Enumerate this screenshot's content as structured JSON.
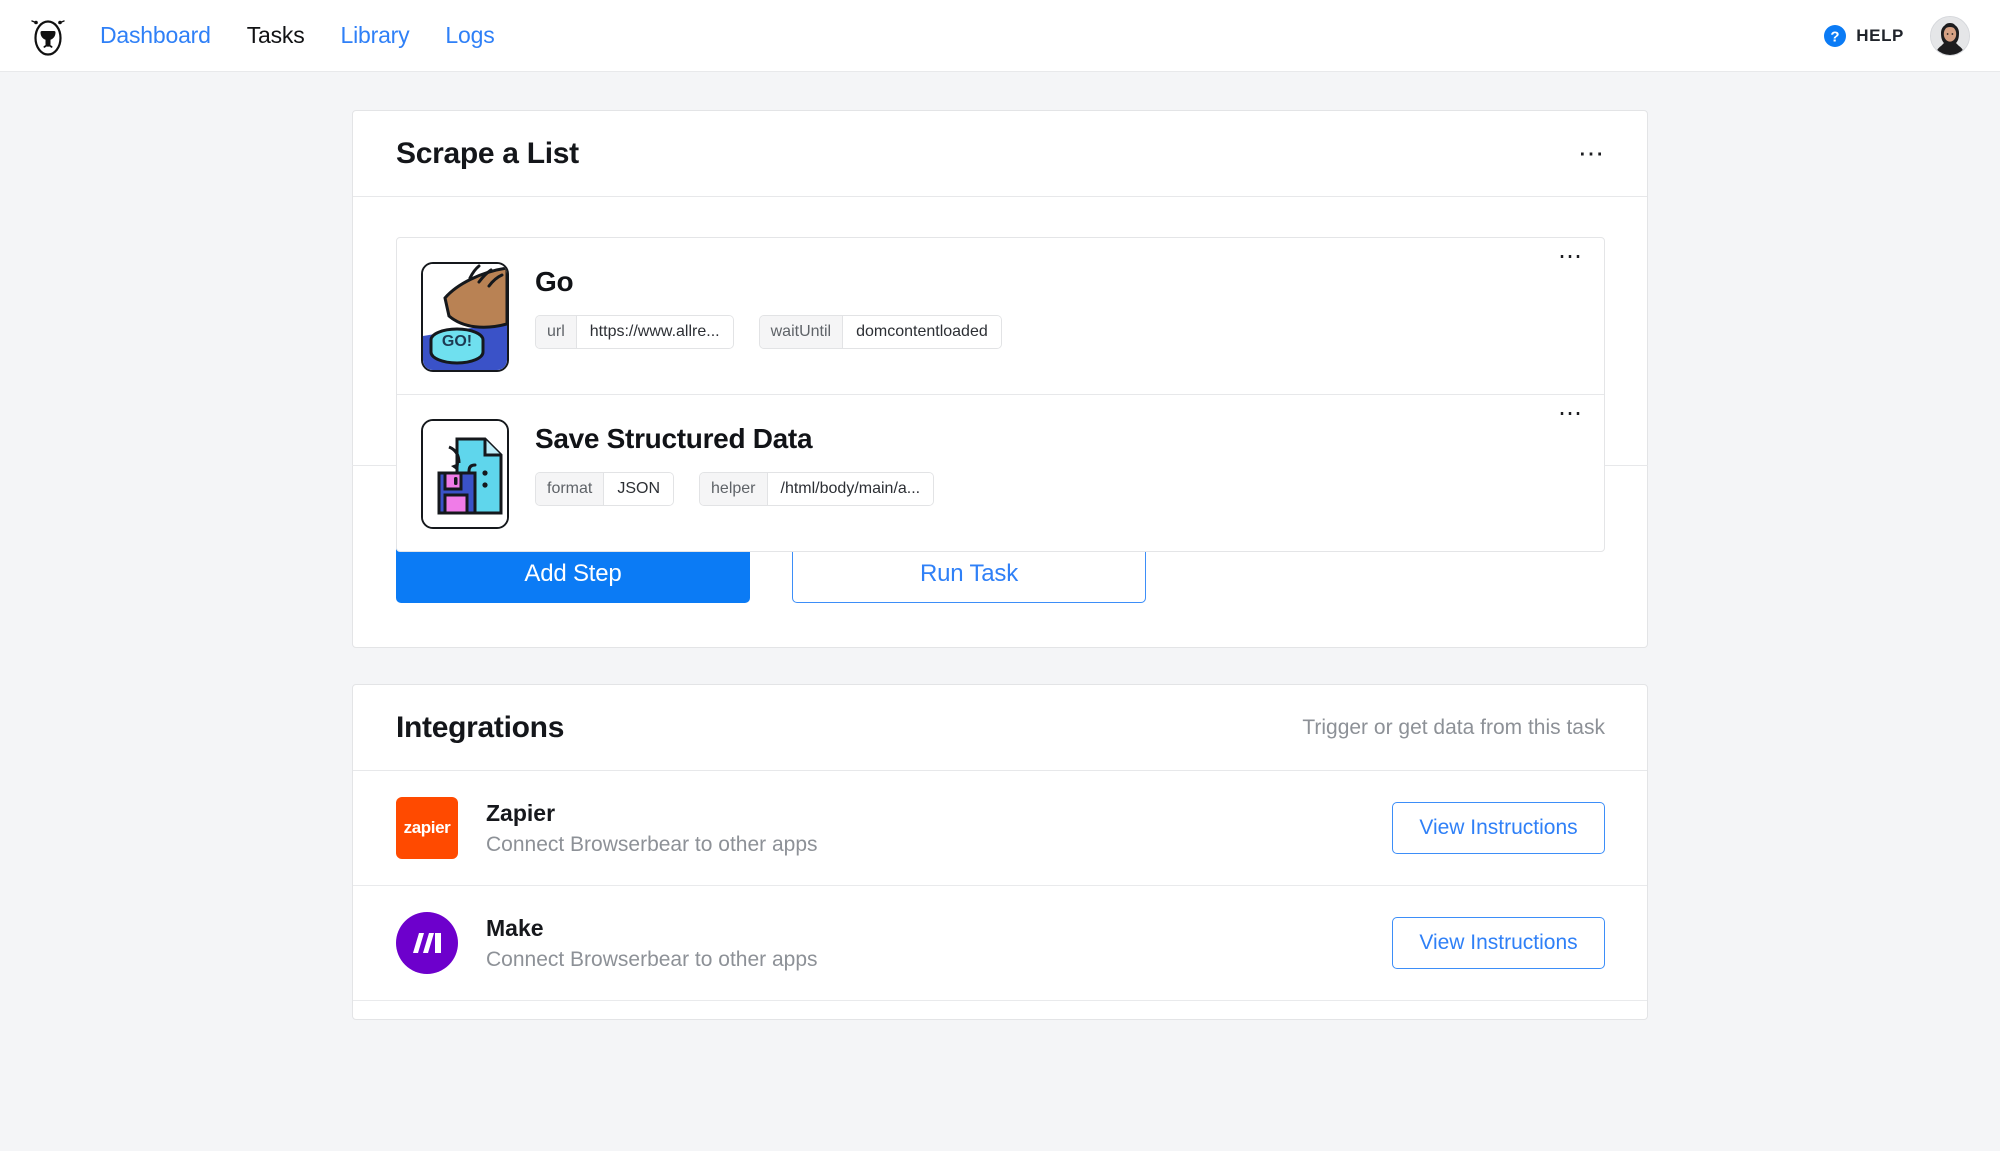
{
  "nav": {
    "logo_icon": "bear-logo-icon",
    "links": [
      {
        "label": "Dashboard",
        "active": false
      },
      {
        "label": "Tasks",
        "active": true
      },
      {
        "label": "Library",
        "active": false
      },
      {
        "label": "Logs",
        "active": false
      }
    ],
    "help": {
      "label": "HELP",
      "icon": "question-circle-icon"
    },
    "avatar_icon": "user-avatar-icon"
  },
  "task_card": {
    "title": "Scrape a List",
    "menu_icon": "ellipsis-icon",
    "steps": [
      {
        "name": "Go",
        "icon": "go-button-press-icon",
        "menu_icon": "ellipsis-icon",
        "params": [
          {
            "key": "url",
            "value": "https://www.allre..."
          },
          {
            "key": "waitUntil",
            "value": "domcontentloaded"
          }
        ]
      },
      {
        "name": "Save Structured Data",
        "icon": "save-structured-data-icon",
        "menu_icon": "ellipsis-icon",
        "params": [
          {
            "key": "format",
            "value": "JSON"
          },
          {
            "key": "helper",
            "value": "/html/body/main/a..."
          }
        ]
      }
    ],
    "actions": {
      "add_step": "Add Step",
      "run_task": "Run Task",
      "annotation_icon": "orange-curly-arrow-icon"
    }
  },
  "integrations": {
    "title": "Integrations",
    "subtitle": "Trigger or get data from this task",
    "rows": [
      {
        "name": "Zapier",
        "desc": "Connect Browserbear to other apps",
        "logo_icon": "zapier-logo-icon",
        "logo_text": "zapier",
        "button": "View Instructions"
      },
      {
        "name": "Make",
        "desc": "Connect Browserbear to other apps",
        "logo_icon": "make-logo-icon",
        "logo_text": "",
        "button": "View Instructions"
      }
    ]
  },
  "colors": {
    "accent_blue": "#0b7bf5",
    "link_blue": "#2f80f7",
    "zapier_orange": "#ff4a00",
    "make_purple": "#6d00cc",
    "annotation_orange": "#f7941d",
    "page_bg": "#f4f5f7"
  }
}
